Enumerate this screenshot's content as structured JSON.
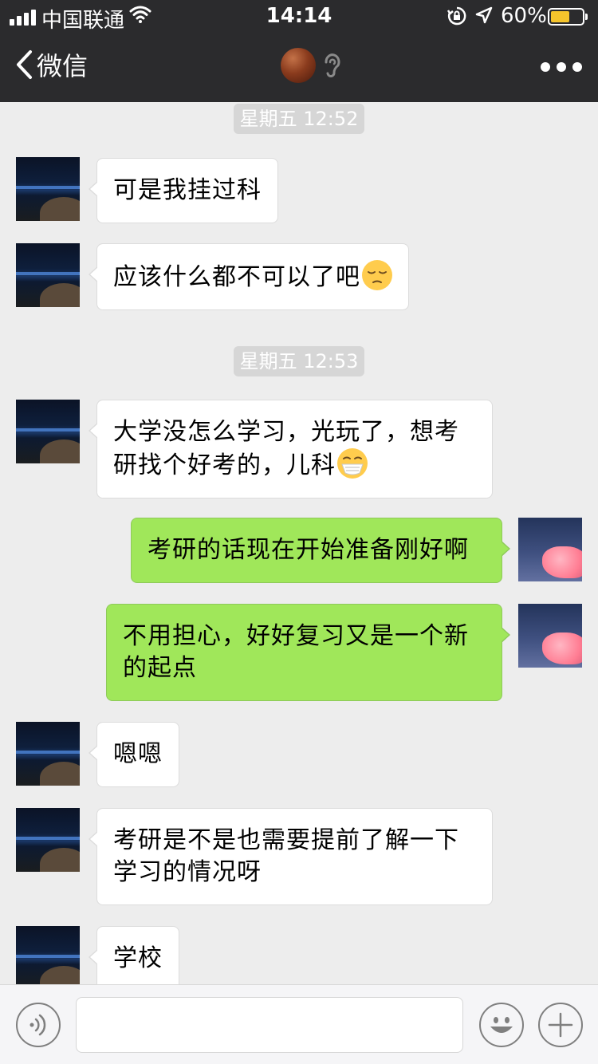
{
  "status_bar": {
    "carrier": "中国联通",
    "time": "14:14",
    "battery_percent": "60%",
    "battery_level": 0.6,
    "battery_color": "#f5c42c"
  },
  "nav": {
    "back_label": "微信",
    "icons": [
      "chevron-left-icon",
      "contact-avatar",
      "ear-icon",
      "more-icon"
    ]
  },
  "messages": [
    {
      "type": "time",
      "text": "星期五 12:52"
    },
    {
      "side": "left",
      "lines": [
        "可是我挂过科"
      ]
    },
    {
      "side": "left",
      "lines": [
        "应该什么都不可以了吧"
      ],
      "emoji": "pensive-face-emoji"
    },
    {
      "type": "time",
      "text": "星期五 12:53"
    },
    {
      "side": "left",
      "lines": [
        "大学没怎么学习，光玩了，想考",
        "研找个好考的，儿科"
      ],
      "emoji": "mask-face-emoji"
    },
    {
      "side": "right",
      "lines": [
        "考研的话现在开始准备刚好啊"
      ]
    },
    {
      "side": "right",
      "lines": [
        "不用担心，好好复习又是一个新",
        "的起点"
      ]
    },
    {
      "side": "left",
      "lines": [
        "嗯嗯"
      ]
    },
    {
      "side": "left",
      "lines": [
        "考研是不是也需要提前了解一下",
        "学习的情况呀"
      ]
    },
    {
      "side": "left",
      "lines": [
        "学校"
      ]
    }
  ],
  "input_bar": {
    "value": "",
    "icons": [
      "voice-icon",
      "emoji-icon",
      "plus-icon"
    ]
  },
  "colors": {
    "header_bg": "#2b2b2d",
    "chat_bg": "#ededed",
    "sent_bubble": "#a0e75a",
    "received_bubble": "#ffffff"
  }
}
